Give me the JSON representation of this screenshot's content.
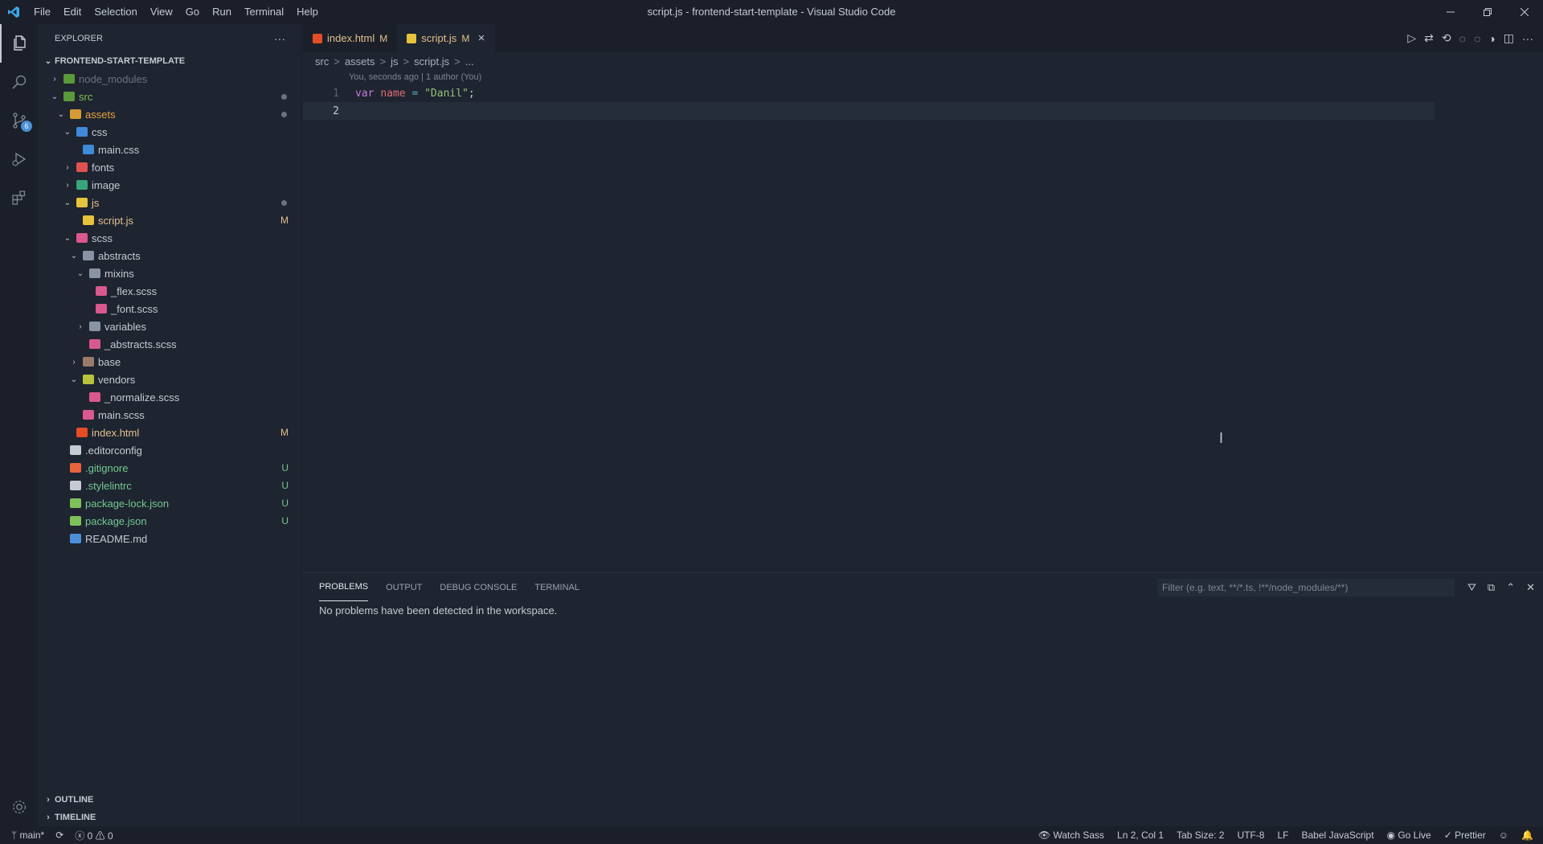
{
  "window": {
    "title": "script.js - frontend-start-template - Visual Studio Code",
    "menu": [
      "File",
      "Edit",
      "Selection",
      "View",
      "Go",
      "Run",
      "Terminal",
      "Help"
    ]
  },
  "activity": {
    "scm_badge": "6"
  },
  "sidebar": {
    "title": "EXPLORER",
    "more": "···",
    "root": "FRONTEND-START-TEMPLATE",
    "outline": "OUTLINE",
    "timeline": "TIMELINE",
    "tree": [
      {
        "name": "node_modules",
        "depth": 0,
        "chev": "›",
        "color": "#6b7280",
        "icon": "#5a9a3a"
      },
      {
        "name": "src",
        "depth": 0,
        "chev": "⌄",
        "color": "#7ec05a",
        "icon": "#5a9a3a",
        "dot": true
      },
      {
        "name": "assets",
        "depth": 1,
        "chev": "⌄",
        "color": "#e8a33d",
        "icon": "#d69b34",
        "dot": true
      },
      {
        "name": "css",
        "depth": 2,
        "chev": "⌄",
        "color": "#c5cad3",
        "icon": "#3f8ad8"
      },
      {
        "name": "main.css",
        "depth": 3,
        "chev": "",
        "color": "#c5cad3",
        "icon": "#3f8ad8"
      },
      {
        "name": "fonts",
        "depth": 2,
        "chev": "›",
        "color": "#c5cad3",
        "icon": "#e05252"
      },
      {
        "name": "image",
        "depth": 2,
        "chev": "›",
        "color": "#c5cad3",
        "icon": "#3aa57a"
      },
      {
        "name": "js",
        "depth": 2,
        "chev": "⌄",
        "color": "#e2c08d",
        "icon": "#e6c33c",
        "dot": true
      },
      {
        "name": "script.js",
        "depth": 3,
        "chev": "",
        "color": "#e2c08d",
        "icon": "#e6c33c",
        "status": "M"
      },
      {
        "name": "scss",
        "depth": 2,
        "chev": "⌄",
        "color": "#c5cad3",
        "icon": "#d9588e"
      },
      {
        "name": "abstracts",
        "depth": 3,
        "chev": "⌄",
        "color": "#c5cad3",
        "icon": "#8a93a3"
      },
      {
        "name": "mixins",
        "depth": 4,
        "chev": "⌄",
        "color": "#c5cad3",
        "icon": "#8a93a3"
      },
      {
        "name": "_flex.scss",
        "depth": 5,
        "chev": "",
        "color": "#c5cad3",
        "icon": "#d9588e"
      },
      {
        "name": "_font.scss",
        "depth": 5,
        "chev": "",
        "color": "#c5cad3",
        "icon": "#d9588e"
      },
      {
        "name": "variables",
        "depth": 4,
        "chev": "›",
        "color": "#c5cad3",
        "icon": "#8a93a3"
      },
      {
        "name": "_abstracts.scss",
        "depth": 4,
        "chev": "",
        "color": "#c5cad3",
        "icon": "#d9588e"
      },
      {
        "name": "base",
        "depth": 3,
        "chev": "›",
        "color": "#c5cad3",
        "icon": "#9a7a6a"
      },
      {
        "name": "vendors",
        "depth": 3,
        "chev": "⌄",
        "color": "#c5cad3",
        "icon": "#b8c23c"
      },
      {
        "name": "_normalize.scss",
        "depth": 4,
        "chev": "",
        "color": "#c5cad3",
        "icon": "#d9588e"
      },
      {
        "name": "main.scss",
        "depth": 3,
        "chev": "",
        "color": "#c5cad3",
        "icon": "#d9588e"
      },
      {
        "name": "index.html",
        "depth": 2,
        "chev": "",
        "color": "#e2c08d",
        "icon": "#e44d26",
        "status": "M"
      },
      {
        "name": ".editorconfig",
        "depth": 1,
        "chev": "",
        "color": "#c5cad3",
        "icon": "#c5cad3"
      },
      {
        "name": ".gitignore",
        "depth": 1,
        "chev": "",
        "color": "#73c991",
        "icon": "#e8623c",
        "status": "U"
      },
      {
        "name": ".stylelintrc",
        "depth": 1,
        "chev": "",
        "color": "#73c991",
        "icon": "#c5cad3",
        "status": "U"
      },
      {
        "name": "package-lock.json",
        "depth": 1,
        "chev": "",
        "color": "#73c991",
        "icon": "#7ec05a",
        "status": "U"
      },
      {
        "name": "package.json",
        "depth": 1,
        "chev": "",
        "color": "#73c991",
        "icon": "#7ec05a",
        "status": "U"
      },
      {
        "name": "README.md",
        "depth": 1,
        "chev": "",
        "color": "#c5cad3",
        "icon": "#4a90d9"
      }
    ]
  },
  "tabs": [
    {
      "label": "index.html",
      "flag": "M",
      "active": false,
      "color": "#e2c08d",
      "icon": "#e44d26"
    },
    {
      "label": "script.js",
      "flag": "M",
      "active": true,
      "color": "#e2c08d",
      "icon": "#e6c33c",
      "close": "✕"
    }
  ],
  "breadcrumb": [
    "src",
    ">",
    "assets",
    ">",
    "js",
    ">",
    "script.js",
    ">",
    "..."
  ],
  "editor": {
    "codelens": "You, seconds ago | 1 author (You)",
    "line1_no": "1",
    "line2_no": "2",
    "kw": "var",
    "varname": "name",
    "eq": "=",
    "str": "\"Danil\"",
    "semi": ";"
  },
  "panel": {
    "tabs": [
      "PROBLEMS",
      "OUTPUT",
      "DEBUG CONSOLE",
      "TERMINAL"
    ],
    "filter_placeholder": "Filter (e.g. text, **/*.ts, !**/node_modules/**)",
    "message": "No problems have been detected in the workspace."
  },
  "status": {
    "branch": "main*",
    "errors": "0",
    "warnings": "0",
    "watch_sass": "Watch Sass",
    "position": "Ln 2, Col 1",
    "tab_size": "Tab Size: 2",
    "encoding": "UTF-8",
    "eol": "LF",
    "language": "Babel JavaScript",
    "go_live": "Go Live",
    "prettier": "Prettier"
  }
}
